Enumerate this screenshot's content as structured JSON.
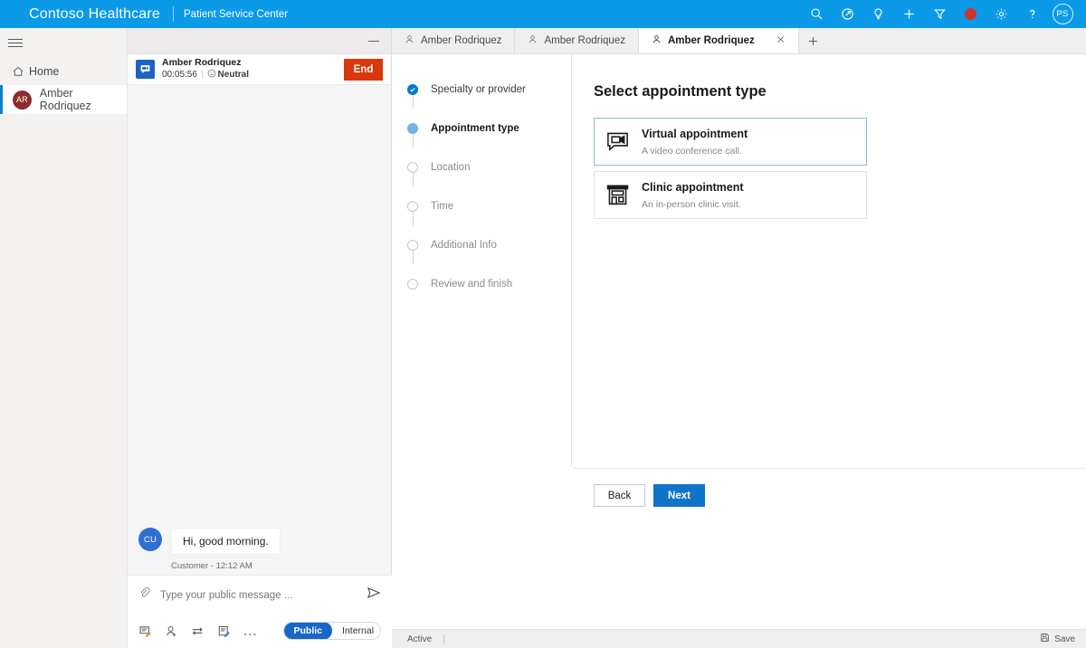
{
  "header": {
    "brand": "Contoso Healthcare",
    "subtitle": "Patient Service Center",
    "accent_color": "#0b9ae8",
    "icons": [
      {
        "name": "search-icon",
        "glyph": "search"
      },
      {
        "name": "assistant-icon",
        "glyph": "compass"
      },
      {
        "name": "insights-lightbulb-icon",
        "glyph": "lightbulb"
      },
      {
        "name": "add-icon",
        "glyph": "plus"
      },
      {
        "name": "filter-icon",
        "glyph": "funnel"
      },
      {
        "name": "recording-indicator",
        "glyph": "dot",
        "color": "#d0342c"
      },
      {
        "name": "settings-gear-icon",
        "glyph": "gear"
      },
      {
        "name": "help-icon",
        "glyph": "question"
      }
    ],
    "user_initials": "PS"
  },
  "sidebar": {
    "menu_label": "Menu",
    "items": [
      {
        "label": "Home",
        "icon": "home-icon",
        "selected": false
      },
      {
        "label": "Amber Rodriquez",
        "icon": "avatar",
        "initials": "AR",
        "selected": true,
        "avatar_color": "#8e2a2a"
      }
    ]
  },
  "conversation": {
    "customer_name": "Amber Rodriquez",
    "duration": "00:05:56",
    "sentiment": "Neutral",
    "end_button": "End",
    "messages": [
      {
        "initials": "CU",
        "text": "Hi, good morning.",
        "caption": "Customer - 12:12 AM"
      }
    ],
    "composer": {
      "placeholder": "Type your public message ...",
      "attach_label": "Attach file",
      "send_label": "Send",
      "tools": [
        {
          "name": "quick-replies-icon"
        },
        {
          "name": "add-participant-icon"
        },
        {
          "name": "transfer-icon"
        },
        {
          "name": "notes-icon"
        },
        {
          "name": "more-options-icon",
          "glyph": "..."
        }
      ],
      "visibility": {
        "public": "Public",
        "internal": "Internal",
        "active": "Public"
      }
    }
  },
  "workspace": {
    "tabs": [
      {
        "label": "Amber Rodriquez",
        "active": false,
        "closable": false
      },
      {
        "label": "Amber Rodriquez",
        "active": false,
        "closable": false
      },
      {
        "label": "Amber Rodriquez",
        "active": true,
        "closable": true
      }
    ],
    "new_tab_label": "+",
    "wizard": {
      "steps": [
        {
          "label": "Specialty or provider",
          "state": "done"
        },
        {
          "label": "Appointment type",
          "state": "current"
        },
        {
          "label": "Location",
          "state": "pending"
        },
        {
          "label": "Time",
          "state": "pending"
        },
        {
          "label": "Additional Info",
          "state": "pending"
        },
        {
          "label": "Review and finish",
          "state": "pending"
        }
      ],
      "title": "Select appointment type",
      "options": [
        {
          "title": "Virtual appointment",
          "description": "A video conference call.",
          "icon": "video-chat-icon",
          "selected": true
        },
        {
          "title": "Clinic appointment",
          "description": "An in-person clinic visit.",
          "icon": "clinic-building-icon",
          "selected": false
        }
      ],
      "back_button": "Back",
      "next_button": "Next"
    }
  },
  "statusbar": {
    "status": "Active",
    "save_label": "Save"
  }
}
